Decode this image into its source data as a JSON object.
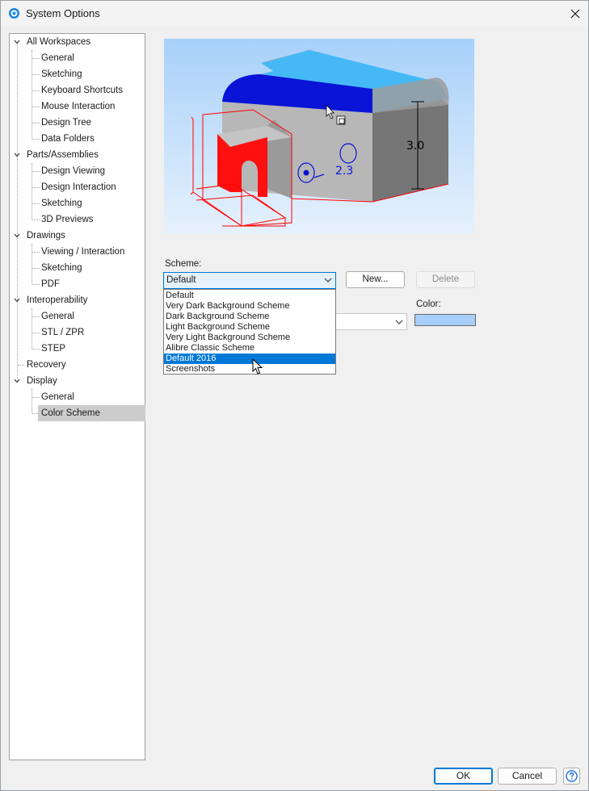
{
  "window": {
    "title": "System Options",
    "icon": "gear-circle-icon",
    "close_icon": "close-icon"
  },
  "tree": {
    "groups": [
      {
        "label": "All Workspaces",
        "children": [
          "General",
          "Sketching",
          "Keyboard Shortcuts",
          "Mouse Interaction",
          "Design Tree",
          "Data Folders"
        ]
      },
      {
        "label": "Parts/Assemblies",
        "children": [
          "Design Viewing",
          "Design Interaction",
          "Sketching",
          "3D Previews"
        ]
      },
      {
        "label": "Drawings",
        "children": [
          "Viewing / Interaction",
          "Sketching",
          "PDF"
        ]
      },
      {
        "label": "Interoperability",
        "children": [
          "General",
          "STL / ZPR",
          "STEP"
        ]
      },
      {
        "label": "Recovery",
        "children": []
      },
      {
        "label": "Display",
        "children": [
          "General",
          "Color Scheme"
        ]
      }
    ],
    "selected": "Color Scheme"
  },
  "preview": {
    "dimension_vertical": "3.0",
    "dimension_horizontal": "2.3",
    "colors": {
      "background_top": "#a7d0fa",
      "face_top": "#45b9f5",
      "face_highlight": "#0a14d6",
      "face_side": "#7d7d7d",
      "sketch_red": "#ff0000"
    }
  },
  "scheme": {
    "label": "Scheme:",
    "selected": "Default",
    "options": [
      "Default",
      "Very Dark Background Scheme",
      "Dark Background Scheme",
      "Light Background Scheme",
      "Very Light Background Scheme",
      "Alibre Classic Scheme",
      "Default 2016",
      "Screenshots"
    ],
    "highlighted": "Default 2016",
    "new_button": "New...",
    "delete_button": "Delete"
  },
  "color": {
    "label": "Color:",
    "value": "#a7cffa"
  },
  "footer": {
    "ok": "OK",
    "cancel": "Cancel",
    "help_icon": "help-icon"
  }
}
